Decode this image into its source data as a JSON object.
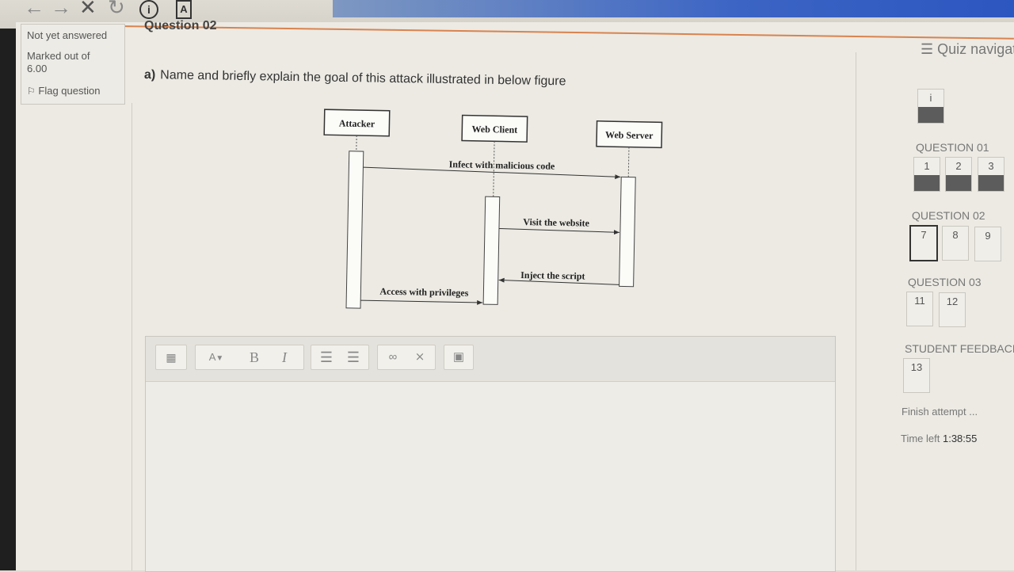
{
  "info": {
    "state": "Not yet answered",
    "marked_out_of_label": "Marked out of",
    "marked_out_of_value": "6.00",
    "flag_label": "Flag question"
  },
  "question_title": "Question 02",
  "question": {
    "part": "a)",
    "text": "Name and briefly explain the goal of this attack illustrated in below figure"
  },
  "diagram": {
    "actors": [
      "Attacker",
      "Web Client",
      "Web Server"
    ],
    "messages": [
      "Infect with malicious code",
      "Visit the website",
      "Inject the script",
      "Access with privileges"
    ]
  },
  "editor": {
    "toolbar_icons": [
      "show-more-icon",
      "font-color-icon",
      "bold-icon",
      "italic-icon",
      "unordered-list-icon",
      "ordered-list-icon",
      "link-icon",
      "unlink-icon",
      "image-icon"
    ],
    "bold_label": "B",
    "italic_label": "I",
    "font_label": "A"
  },
  "quiz_nav": {
    "title": "Quiz navigation",
    "info_box": "i",
    "sections": [
      {
        "heading": "QUESTION 01",
        "items": [
          "1",
          "2",
          "3"
        ]
      },
      {
        "heading": "QUESTION 02",
        "items": [
          "7",
          "8",
          "9"
        ]
      },
      {
        "heading": "QUESTION 03",
        "items": [
          "11",
          "12"
        ]
      },
      {
        "heading": "STUDENT FEEDBACK",
        "items": [
          "13"
        ]
      }
    ],
    "finish_attempt": "Finish attempt ...",
    "time_left_label": "Time left",
    "time_left_value": "1:38:55"
  },
  "colors": {
    "answered_fill": "#5c5c5c",
    "accent_line": "#d9834f",
    "browser_blue": "#2d57c0"
  }
}
